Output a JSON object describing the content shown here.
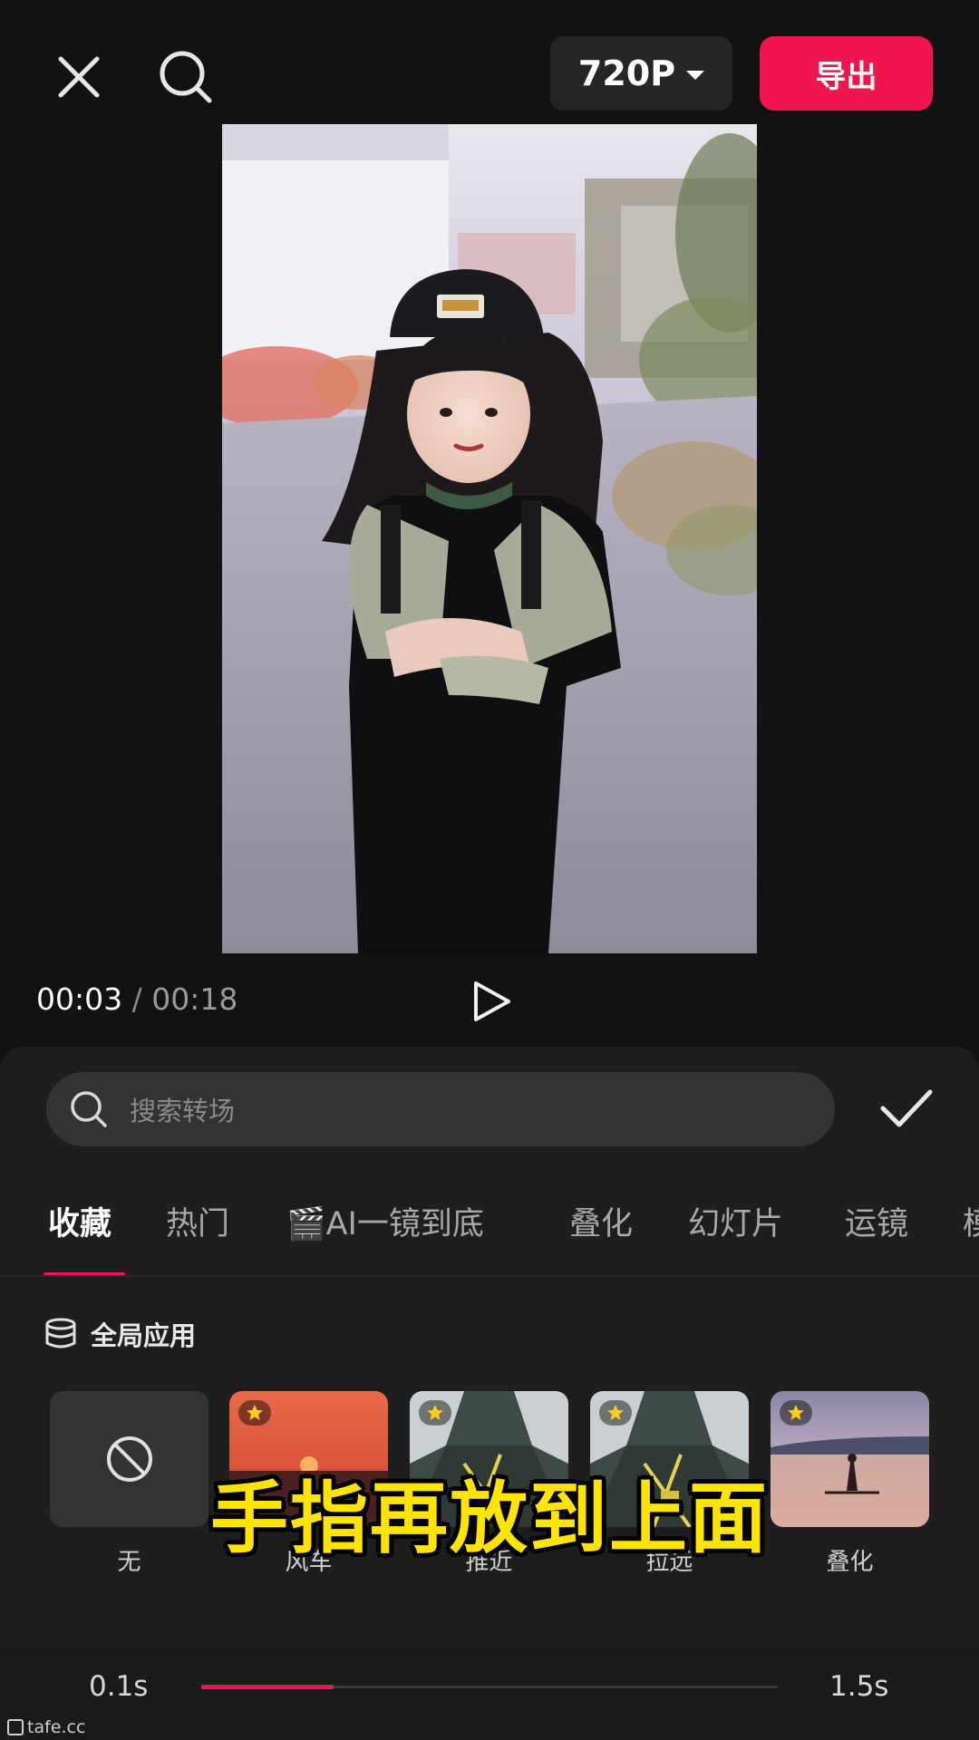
{
  "toolbar": {
    "resolution": "720P",
    "export_label": "导出"
  },
  "player": {
    "current_time": "00:03",
    "separator": "/",
    "total_time": "00:18"
  },
  "search": {
    "placeholder": "搜索转场"
  },
  "tabs": [
    {
      "label": "收藏",
      "active": true
    },
    {
      "label": "热门",
      "active": false
    },
    {
      "label": "🎬AI一镜到底",
      "active": false
    },
    {
      "label": "叠化",
      "active": false
    },
    {
      "label": "幻灯片",
      "active": false
    },
    {
      "label": "运镜",
      "active": false
    },
    {
      "label": "模",
      "active": false
    }
  ],
  "global_apply": "全局应用",
  "transitions": [
    {
      "label": "无",
      "favorite": false
    },
    {
      "label": "风车",
      "favorite": true
    },
    {
      "label": "推近",
      "favorite": true
    },
    {
      "label": "拉远",
      "favorite": true
    },
    {
      "label": "叠化",
      "favorite": true
    }
  ],
  "subtitle": "手指再放到上面",
  "duration": {
    "min_label": "0.1s",
    "max_label": "1.5s",
    "value_fraction": 0.23
  },
  "watermark": "tafe.cc",
  "colors": {
    "accent": "#f0144f",
    "subtitle": "#ffe400",
    "background": "#121212"
  }
}
